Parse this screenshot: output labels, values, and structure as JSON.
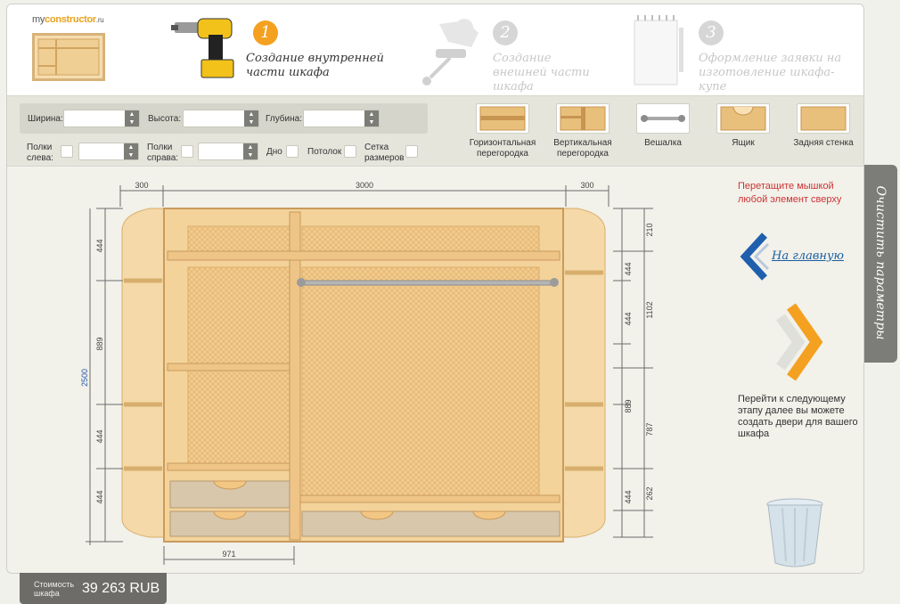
{
  "brand": {
    "logo_prefix": "my",
    "logo_main": "constructor",
    "logo_suffix": ".ru"
  },
  "steps": [
    {
      "num": "1",
      "label": "Создание внутренней части шкафа",
      "active": true
    },
    {
      "num": "2",
      "label": "Создание внешней части шкафа",
      "active": false
    },
    {
      "num": "3",
      "label": "Оформление заявки на изготовление шкафа-купе",
      "active": false
    }
  ],
  "params": {
    "width_label": "Ширина:",
    "height_label": "Высота:",
    "depth_label": "Глубина:",
    "shelves_left_label": "Полки слева:",
    "shelves_right_label": "Полки справа:",
    "bottom_label": "Дно",
    "ceiling_label": "Потолок",
    "grid_label": "Сетка размеров"
  },
  "elements": [
    {
      "label": "Горизонтальная перегородка",
      "icon": "horizontal-partition-icon"
    },
    {
      "label": "Вертикальная перегородка",
      "icon": "vertical-partition-icon"
    },
    {
      "label": "Вешалка",
      "icon": "hanger-rail-icon"
    },
    {
      "label": "Ящик",
      "icon": "drawer-icon"
    },
    {
      "label": "Задняя стенка",
      "icon": "back-wall-icon"
    }
  ],
  "hint": "Перетащите мышкой любой элемент сверху",
  "home_link": "На главную",
  "next_text": "Перейти к следующему этапу далее вы можете создать двери для вашего шкафа",
  "clear_button": "Очистить параметры",
  "cost": {
    "label": "Стоимость шкафа",
    "value": "39 263",
    "currency": "RUB"
  },
  "dimensions": {
    "top": {
      "left": "300",
      "center": "3000",
      "right": "300"
    },
    "total_height": "2500",
    "left_side": [
      "444",
      "889",
      "444",
      "444"
    ],
    "right_outer": [
      "444",
      "444",
      "889",
      "444"
    ],
    "right_inner": [
      "210",
      "1102",
      "787",
      "262"
    ],
    "bottom": "971"
  },
  "colors": {
    "accent": "#f4a020",
    "link": "#1a5fa0",
    "hint": "#cc3333",
    "wood": "#f3d39a",
    "wood_frame": "#e8c384",
    "drawer": "#d9c7ab"
  }
}
